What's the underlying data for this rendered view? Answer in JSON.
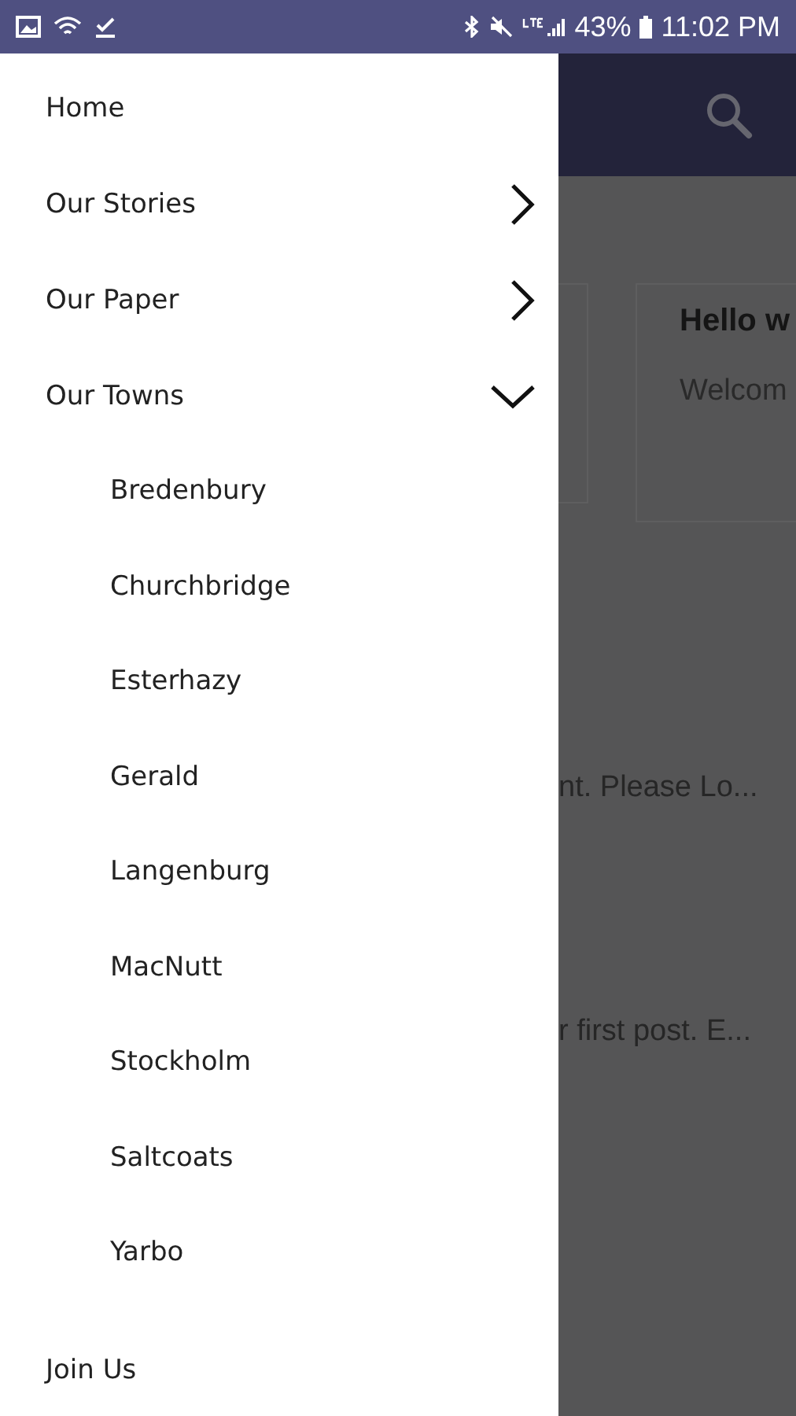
{
  "status_bar": {
    "battery": "43%",
    "time": "11:02 PM"
  },
  "drawer": {
    "items": [
      {
        "label": "Home",
        "kind": "link"
      },
      {
        "label": "Our Stories",
        "kind": "expandable",
        "expanded": false
      },
      {
        "label": "Our Paper",
        "kind": "expandable",
        "expanded": false
      },
      {
        "label": "Our Towns",
        "kind": "expandable",
        "expanded": true,
        "children": [
          {
            "label": "Bredenbury"
          },
          {
            "label": "Churchbridge"
          },
          {
            "label": "Esterhazy"
          },
          {
            "label": "Gerald"
          },
          {
            "label": "Langenburg"
          },
          {
            "label": "MacNutt"
          },
          {
            "label": "Stockholm"
          },
          {
            "label": "Saltcoats"
          },
          {
            "label": "Yarbo"
          }
        ]
      },
      {
        "label": "Join Us",
        "kind": "link"
      }
    ]
  },
  "background": {
    "card": {
      "title": "Hello w",
      "text": "Welcom"
    },
    "posts": [
      {
        "excerpt": "nt. Please Lo..."
      },
      {
        "excerpt": "r first post. E..."
      }
    ]
  }
}
